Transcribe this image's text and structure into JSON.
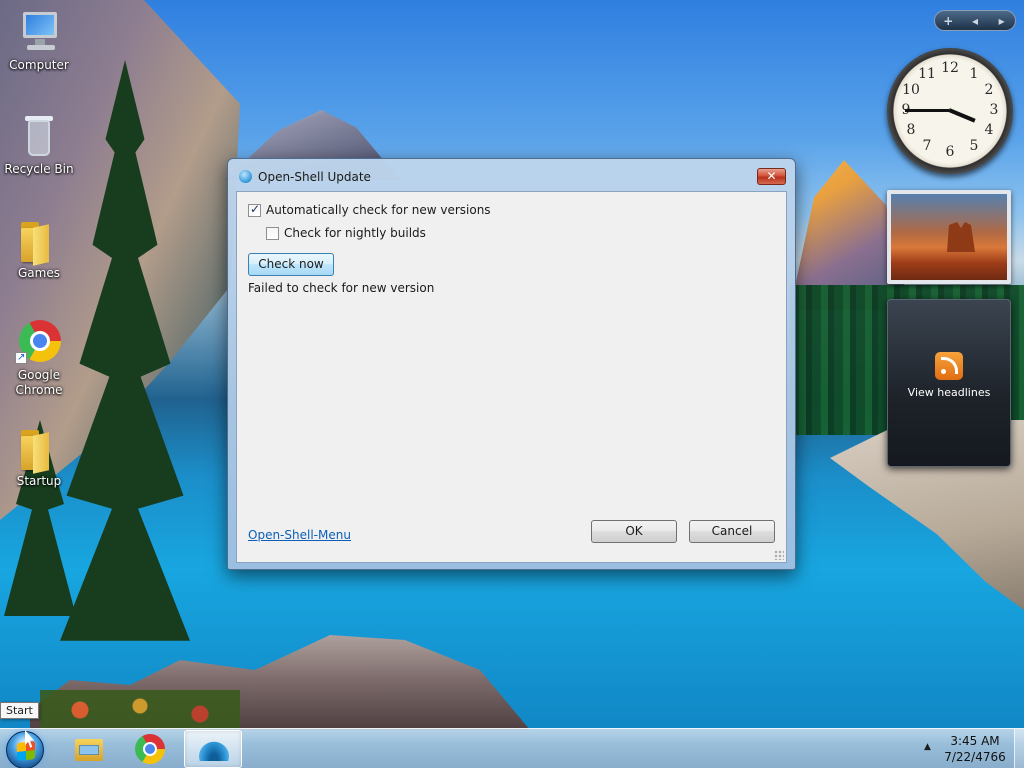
{
  "desktop": {
    "icons": [
      {
        "label": "Computer"
      },
      {
        "label": "Recycle Bin"
      },
      {
        "label": "Games"
      },
      {
        "label": "Google Chrome"
      },
      {
        "label": "Startup"
      }
    ]
  },
  "gadgets": {
    "toolbar": {
      "add": "+",
      "prev": "◂",
      "next": "▸"
    },
    "clock": {
      "numbers": [
        "12",
        "1",
        "2",
        "3",
        "4",
        "5",
        "6",
        "7",
        "8",
        "9",
        "10",
        "11"
      ],
      "time": "3:45"
    },
    "feed": {
      "label": "View headlines"
    }
  },
  "dialog": {
    "title": "Open-Shell Update",
    "close_label": "✕",
    "auto_check": {
      "label": "Automatically check for new versions",
      "checked": true
    },
    "nightly": {
      "label": "Check for nightly builds",
      "checked": false
    },
    "check_now_label": "Check now",
    "status": "Failed to check for new version",
    "link": "Open-Shell-Menu",
    "ok_label": "OK",
    "cancel_label": "Cancel"
  },
  "tooltip": {
    "text": "Start"
  },
  "taskbar": {
    "pinned": [
      {
        "name": "Windows Explorer"
      },
      {
        "name": "Google Chrome"
      },
      {
        "name": "Open-Shell"
      }
    ],
    "tray_arrow": "▲",
    "clock_time": "3:45 AM",
    "clock_date": "7/22/4766"
  },
  "colors": {
    "link": "#0b5fb8",
    "close_button": "#c8402a",
    "taskbar": "#b0c8de"
  }
}
